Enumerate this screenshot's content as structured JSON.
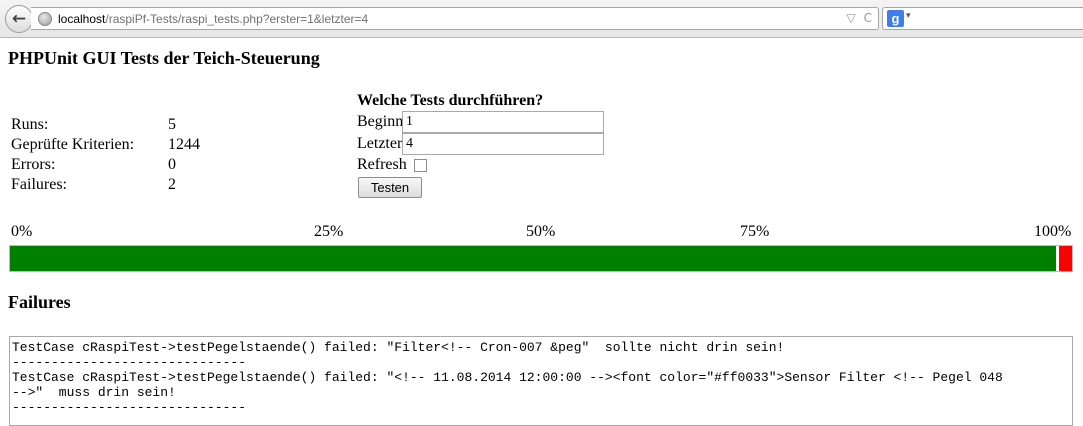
{
  "browser": {
    "url_host": "localhost",
    "url_rest": "/raspiPf-Tests/raspi_tests.php?erster=1&letzter=4",
    "icons": {
      "back": "back-arrow-icon",
      "site": "globe-icon",
      "dropdown": "chevron-down-icon",
      "reload": "reload-icon",
      "search_engine": "google-icon"
    },
    "dropdown_glyph": "▽",
    "reload_glyph": "C",
    "search_engine_glyph": "g",
    "search_arrow_glyph": "▾"
  },
  "page": {
    "title": "PHPUnit GUI Tests der Teich-Steuerung"
  },
  "stats": [
    {
      "label": "Runs:",
      "value": "5"
    },
    {
      "label": "Geprüfte Kriterien:",
      "value": "1244"
    },
    {
      "label": "Errors:",
      "value": "0"
    },
    {
      "label": "Failures:",
      "value": "2"
    }
  ],
  "form": {
    "title": "Welche Tests durchführen?",
    "beginn_label": "Beginn",
    "beginn_value": "1",
    "letzter_label": "Letzter",
    "letzter_value": "4",
    "refresh_label": "Refresh",
    "refresh_checked": false,
    "submit_label": "Testen"
  },
  "progress": {
    "scale_labels": [
      "0%",
      "25%",
      "50%",
      "75%",
      "100%"
    ],
    "pass_fraction": 0.988,
    "fail_fraction": 0.012,
    "colors": {
      "pass": "#008000",
      "fail": "#ff0000"
    }
  },
  "failures": {
    "title": "Failures",
    "text": "TestCase cRaspiTest->testPegelstaende() failed: \"Filter<!-- Cron-007 &peg\"  sollte nicht drin sein!\n------------------------------\nTestCase cRaspiTest->testPegelstaende() failed: \"<!-- 11.08.2014 12:00:00 --><font color=\"#ff0033\">Sensor Filter <!-- Pegel 048\n-->\"  muss drin sein!\n------------------------------"
  }
}
